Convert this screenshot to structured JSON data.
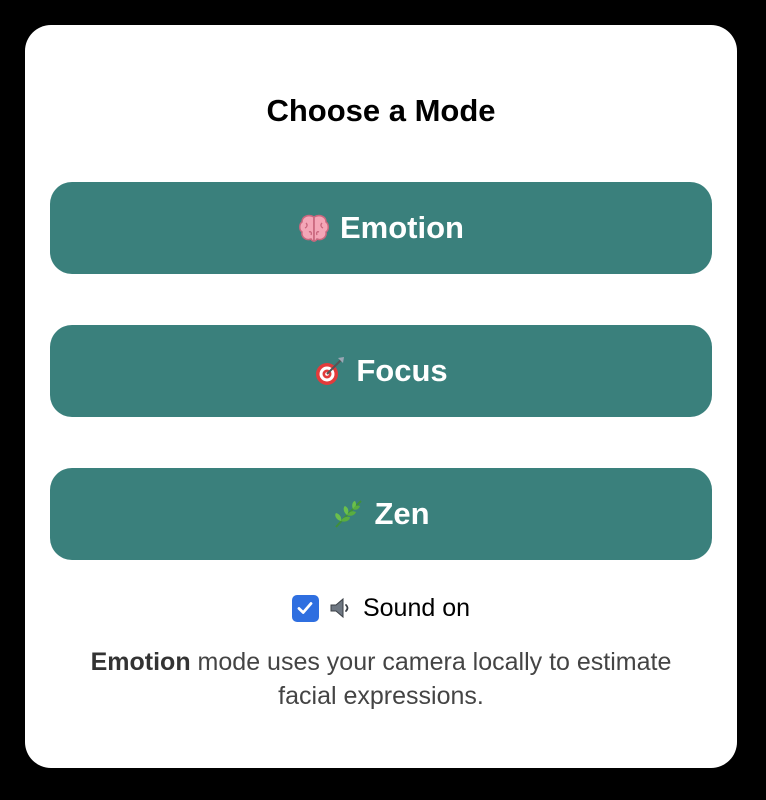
{
  "dialog": {
    "title": "Choose a Mode"
  },
  "modes": [
    {
      "label": "Emotion",
      "icon": "brain-icon"
    },
    {
      "label": "Focus",
      "icon": "target-icon"
    },
    {
      "label": "Zen",
      "icon": "herb-icon"
    }
  ],
  "sound": {
    "checked": true,
    "label": "Sound on",
    "icon": "speaker-icon"
  },
  "description": {
    "mode_name": "Emotion",
    "text": " mode uses your camera locally to estimate facial expressions."
  },
  "colors": {
    "background": "#000000",
    "panel": "#ffffff",
    "button": "#3a807c",
    "checkbox": "#2f6fe0"
  }
}
